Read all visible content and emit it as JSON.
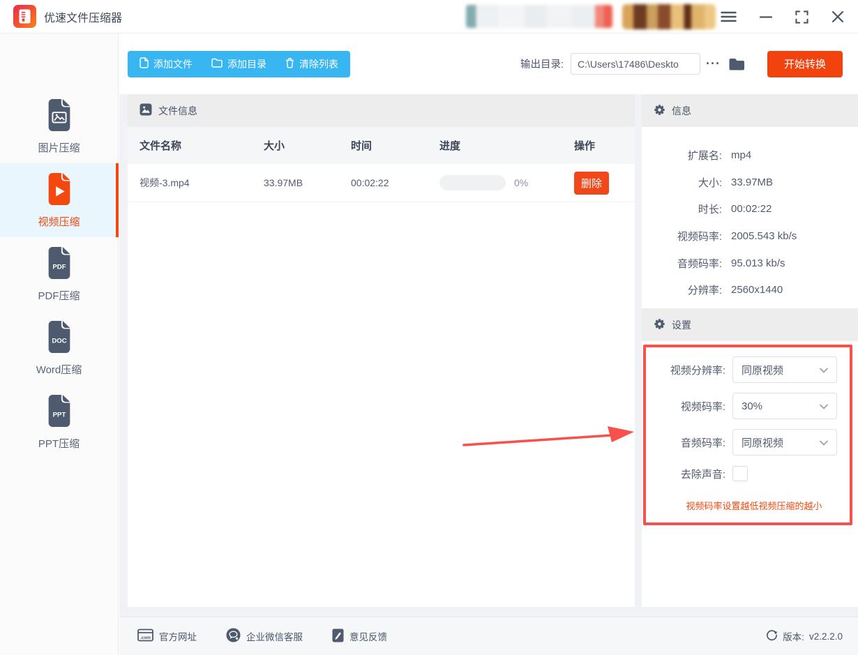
{
  "titlebar": {
    "app_title": "优速文件压缩器"
  },
  "toolbar": {
    "add_file_label": "添加文件",
    "add_dir_label": "添加目录",
    "clear_list_label": "清除列表",
    "output_dir_label": "输出目录:",
    "output_dir_value": "C:\\Users\\17486\\Deskto",
    "more_label": "···",
    "start_button_label": "开始转换"
  },
  "sidebar": {
    "items": [
      {
        "label": "图片压缩"
      },
      {
        "label": "视频压缩"
      },
      {
        "label": "PDF压缩",
        "file_badge": "PDF"
      },
      {
        "label": "Word压缩",
        "file_badge": "DOC"
      },
      {
        "label": "PPT压缩",
        "file_badge": "PPT"
      }
    ]
  },
  "file_panel": {
    "header_title": "文件信息",
    "columns": [
      "文件名称",
      "大小",
      "时间",
      "进度",
      "操作"
    ],
    "row": {
      "name": "视频-3.mp4",
      "size": "33.97MB",
      "time": "00:02:22",
      "progress_percent": "0%",
      "delete_label": "删除"
    }
  },
  "info_panel": {
    "header_title": "信息",
    "rows": [
      {
        "label": "扩展名:",
        "value": "mp4"
      },
      {
        "label": "大小:",
        "value": "33.97MB"
      },
      {
        "label": "时长:",
        "value": "00:02:22"
      },
      {
        "label": "视频码率:",
        "value": "2005.543 kb/s"
      },
      {
        "label": "音频码率:",
        "value": "95.013 kb/s"
      },
      {
        "label": "分辨率:",
        "value": "2560x1440"
      }
    ]
  },
  "settings_panel": {
    "header_title": "设置",
    "video_resolution_label": "视频分辨率:",
    "video_resolution_value": "同原视频",
    "video_bitrate_label": "视频码率:",
    "video_bitrate_value": "30%",
    "audio_bitrate_label": "音频码率:",
    "audio_bitrate_value": "同原视频",
    "remove_audio_label": "去除声音:",
    "note": "视频码率设置越低视频压缩的越小"
  },
  "footer": {
    "website_label": "官方网址",
    "wechat_label": "企业微信客服",
    "feedback_label": "意见反馈",
    "version_label": "版本:",
    "version_value": "v2.2.2.0"
  },
  "colors": {
    "accent_blue": "#38b6f1",
    "accent_orange": "#f2430e",
    "annotation_red": "#f8504d",
    "icon_slate": "#4e5a6e",
    "active_item_bg": "#e9f6fe"
  }
}
